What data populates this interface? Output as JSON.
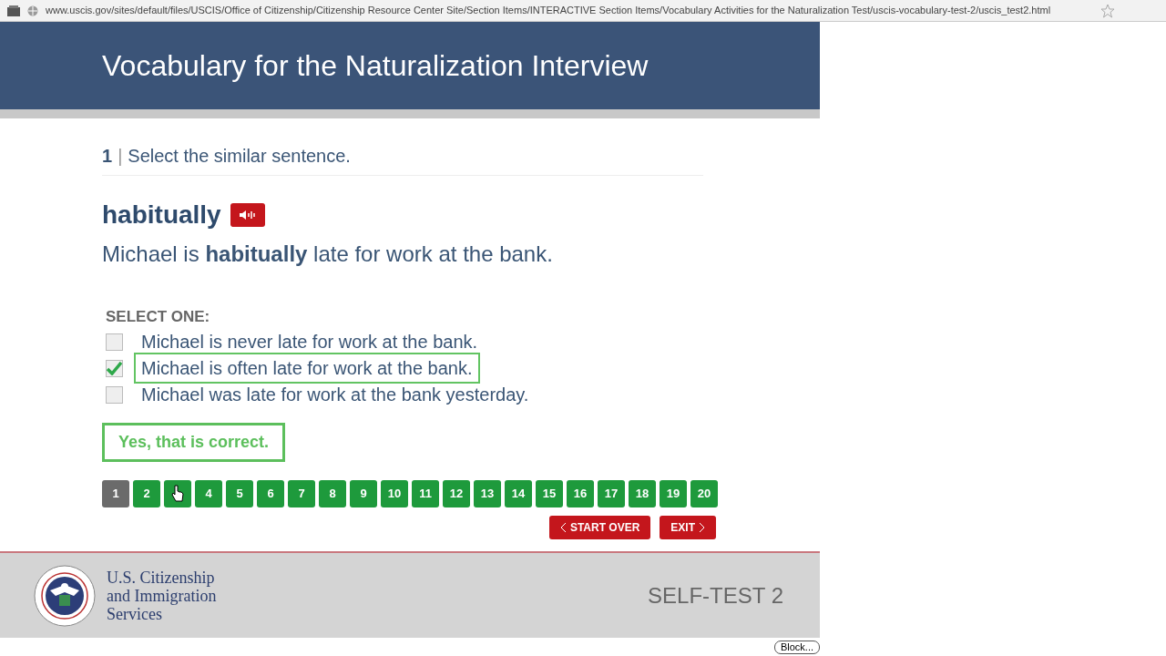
{
  "browser": {
    "url": "www.uscis.gov/sites/default/files/USCIS/Office of Citizenship/Citizenship Resource Center Site/Section Items/INTERACTIVE Section Items/Vocabulary Activities for the Naturalization Test/uscis-vocabulary-test-2/uscis_test2.html"
  },
  "header": {
    "title": "Vocabulary for the Naturalization Interview"
  },
  "question": {
    "number": "1",
    "separator": "|",
    "prompt": "Select the similar sentence.",
    "word": "habitually",
    "example": "Michael is **habitually** late for work at the bank."
  },
  "answers": {
    "label": "SELECT ONE:",
    "options": [
      {
        "text": "Michael is never late for work at the bank.",
        "checked": false
      },
      {
        "text": "Michael is often late for work at the bank.",
        "checked": true
      },
      {
        "text": "Michael was late for work at the bank yesterday.",
        "checked": false
      }
    ]
  },
  "feedback": "Yes, that is correct.",
  "pages": [
    {
      "label": "1",
      "selected": true
    },
    {
      "label": "2",
      "selected": false
    },
    {
      "selected": false
    },
    {
      "label": "4",
      "selected": false
    },
    {
      "label": "5",
      "selected": false
    },
    {
      "label": "6",
      "selected": false
    },
    {
      "label": "7",
      "selected": false
    },
    {
      "label": "8",
      "selected": false
    },
    {
      "label": "9",
      "selected": false
    },
    {
      "label": "10",
      "selected": false
    },
    {
      "label": "11",
      "selected": false
    },
    {
      "label": "12",
      "selected": false
    },
    {
      "label": "13",
      "selected": false
    },
    {
      "label": "14",
      "selected": false
    },
    {
      "label": "15",
      "selected": false
    },
    {
      "label": "16",
      "selected": false
    },
    {
      "label": "17",
      "selected": false
    },
    {
      "label": "18",
      "selected": false
    },
    {
      "label": "19",
      "selected": false
    },
    {
      "label": "20",
      "selected": false
    }
  ],
  "actions": [
    {
      "label": "START OVER",
      "kind": "back"
    },
    {
      "label": "EXIT",
      "kind": "forward"
    }
  ],
  "footer": {
    "agency": [
      "U.S. Citizenship",
      "and Immigration",
      "Services"
    ],
    "test_name": "SELF-TEST 2"
  },
  "popup_button": "Block..."
}
